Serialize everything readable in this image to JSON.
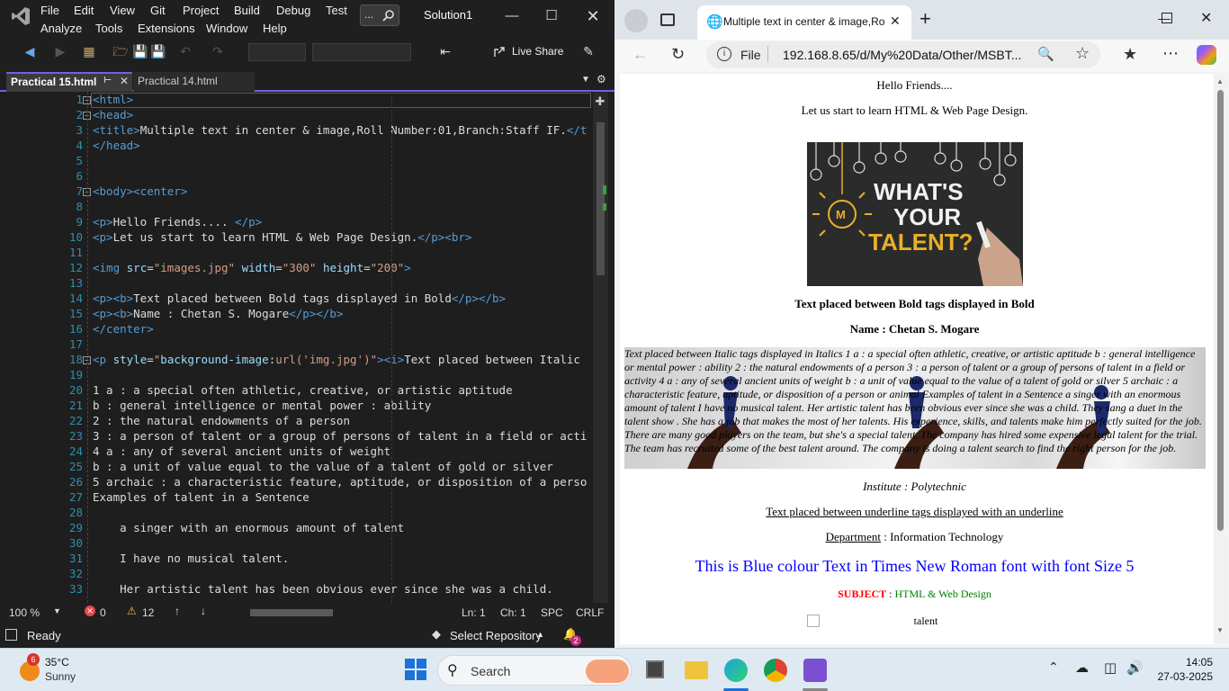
{
  "vs": {
    "menu": [
      "File",
      "Edit",
      "View",
      "Git",
      "Project",
      "Build",
      "Debug",
      "Test",
      "Analyze",
      "Tools",
      "Extensions",
      "Window",
      "Help"
    ],
    "search_dots": "...",
    "solution": "Solution1",
    "live_share": "Live Share",
    "tabs": [
      {
        "label": "Practical 15.html",
        "active": true
      },
      {
        "label": "Practical 14.html",
        "active": false
      }
    ],
    "lines": [
      {
        "n": "1",
        "html": "<span class=\"t\">&lt;html&gt;</span>"
      },
      {
        "n": "2",
        "html": "<span class=\"t\">&lt;head&gt;</span>"
      },
      {
        "n": "3",
        "html": "<span class=\"t\">&lt;title&gt;</span>Multiple text in center &amp; image,Roll Number:01,Branch:Staff IF.<span class=\"t\">&lt;/t</span>"
      },
      {
        "n": "4",
        "html": "<span class=\"t\">&lt;/head&gt;</span>"
      },
      {
        "n": "5",
        "html": ""
      },
      {
        "n": "6",
        "html": ""
      },
      {
        "n": "7",
        "html": "<span class=\"t\">&lt;body&gt;&lt;center&gt;</span>"
      },
      {
        "n": "8",
        "html": ""
      },
      {
        "n": "9",
        "html": "<span class=\"t\">&lt;p&gt;</span>Hello Friends.... <span class=\"t\">&lt;/p&gt;</span>"
      },
      {
        "n": "10",
        "html": "<span class=\"t\">&lt;p&gt;</span>Let us start to learn HTML &amp; Web Page Design.<span class=\"t\">&lt;/p&gt;&lt;br&gt;</span>"
      },
      {
        "n": "11",
        "html": ""
      },
      {
        "n": "12",
        "html": "<span class=\"t\">&lt;img</span> <span class=\"a\">src</span>=<span class=\"s\">\"images.jpg\"</span> <span class=\"a\">width</span>=<span class=\"s\">\"300\"</span> <span class=\"a\">height</span>=<span class=\"s\">\"200\"</span><span class=\"t\">&gt;</span>"
      },
      {
        "n": "13",
        "html": ""
      },
      {
        "n": "14",
        "html": "<span class=\"t\">&lt;p&gt;&lt;b&gt;</span>Text placed between Bold tags displayed in Bold<span class=\"t\">&lt;/p&gt;&lt;/b&gt;</span>"
      },
      {
        "n": "15",
        "html": "<span class=\"t\">&lt;p&gt;&lt;b&gt;</span>Name : Chetan S. Mogare<span class=\"t\">&lt;/p&gt;&lt;/b&gt;</span>"
      },
      {
        "n": "16",
        "html": "<span class=\"t\">&lt;/center&gt;</span>"
      },
      {
        "n": "17",
        "html": ""
      },
      {
        "n": "18",
        "html": "<span class=\"t\">&lt;p</span> <span class=\"a\">style</span>=<span class=\"s\">\"</span><span class=\"a\">background-image</span>:<span class=\"s\">url('img.jpg')\"</span><span class=\"t\">&gt;&lt;i&gt;</span>Text placed between Italic"
      },
      {
        "n": "19",
        "html": ""
      },
      {
        "n": "20",
        "html": "1 a : a special often athletic, creative, or artistic aptitude"
      },
      {
        "n": "21",
        "html": "b : general intelligence or mental power : ability"
      },
      {
        "n": "22",
        "html": "2 : the natural endowments of a person"
      },
      {
        "n": "23",
        "html": "3 : a person of talent or a group of persons of talent in a field or acti"
      },
      {
        "n": "24",
        "html": "4 a : any of several ancient units of weight"
      },
      {
        "n": "25",
        "html": "b : a unit of value equal to the value of a talent of gold or silver"
      },
      {
        "n": "26",
        "html": "5 archaic : a characteristic feature, aptitude, or disposition of a perso"
      },
      {
        "n": "27",
        "html": "Examples of talent in a Sentence"
      },
      {
        "n": "28",
        "html": ""
      },
      {
        "n": "29",
        "html": "    a singer with an enormous amount of talent"
      },
      {
        "n": "30",
        "html": ""
      },
      {
        "n": "31",
        "html": "    I have no musical talent."
      },
      {
        "n": "32",
        "html": ""
      },
      {
        "n": "33",
        "html": "    Her artistic talent has been obvious ever since she was a child."
      }
    ],
    "status": {
      "zoom": "100 %",
      "errors": "0",
      "warnings": "12",
      "ln": "Ln: 1",
      "ch": "Ch: 1",
      "spc": "SPC",
      "crlf": "CRLF"
    },
    "bottom": {
      "ready": "Ready",
      "select_repo": "Select Repository",
      "notif_count": "2"
    }
  },
  "browser": {
    "tab_title": "Multiple text in center & image,Ro",
    "file_label": "File",
    "url": "192.168.8.65/d/My%20Data/Other/MSBT...",
    "page": {
      "hello": "Hello Friends....",
      "learn": "Let us start to learn HTML & Web Page Design.",
      "img_text": {
        "l1": "WHAT'S",
        "l2": "YOUR",
        "l3": "TALENT?"
      },
      "bold": "Text placed between Bold tags displayed in Bold",
      "name": "Name : Chetan S. Mogare",
      "italic": "Text placed between Italic tags displayed in Italics 1 a : a special often athletic, creative, or artistic aptitude b : general intelligence or mental power : ability 2 : the natural endowments of a person 3 : a person of talent or a group of persons of talent in a field or activity 4 a : any of several ancient units of weight b : a unit of value equal to the value of a talent of gold or silver 5 archaic : a characteristic feature, aptitude, or disposition of a person or animal Examples of talent in a Sentence a singer with an enormous amount of talent I have no musical talent. Her artistic talent has been obvious ever since she was a child. They sang a duet in the talent show . She has a job that makes the most of her talents. His experience, skills, and talents make him perfectly suited for the job. There are many good players on the team, but she's a special talent. The company has hired some expensive legal talent for the trial. The team has recruited some of the best talent around. The company is doing a talent search to find the right person for the job.",
      "institute": "Institute : Polytechnic",
      "underline": "Text placed between underline tags displayed with an underline",
      "dept_label": "Department",
      "dept_value": " : Information Technology",
      "blue": "This is Blue colour Text in Times New Roman font with font Size 5",
      "subject_label": "SUBJECT",
      "subject_sep": " : ",
      "subject_value": "HTML & Web Design",
      "img_alt": "talent"
    }
  },
  "taskbar": {
    "temp": "35°C",
    "weather": "Sunny",
    "weather_badge": "6",
    "search": "Search",
    "time": "14:05",
    "date": "27-03-2025"
  },
  "colors": {
    "vs_accent": "#7160e8",
    "blue_text": "#0000ff",
    "subject": "#ff0000",
    "subject_value": "#008000"
  }
}
